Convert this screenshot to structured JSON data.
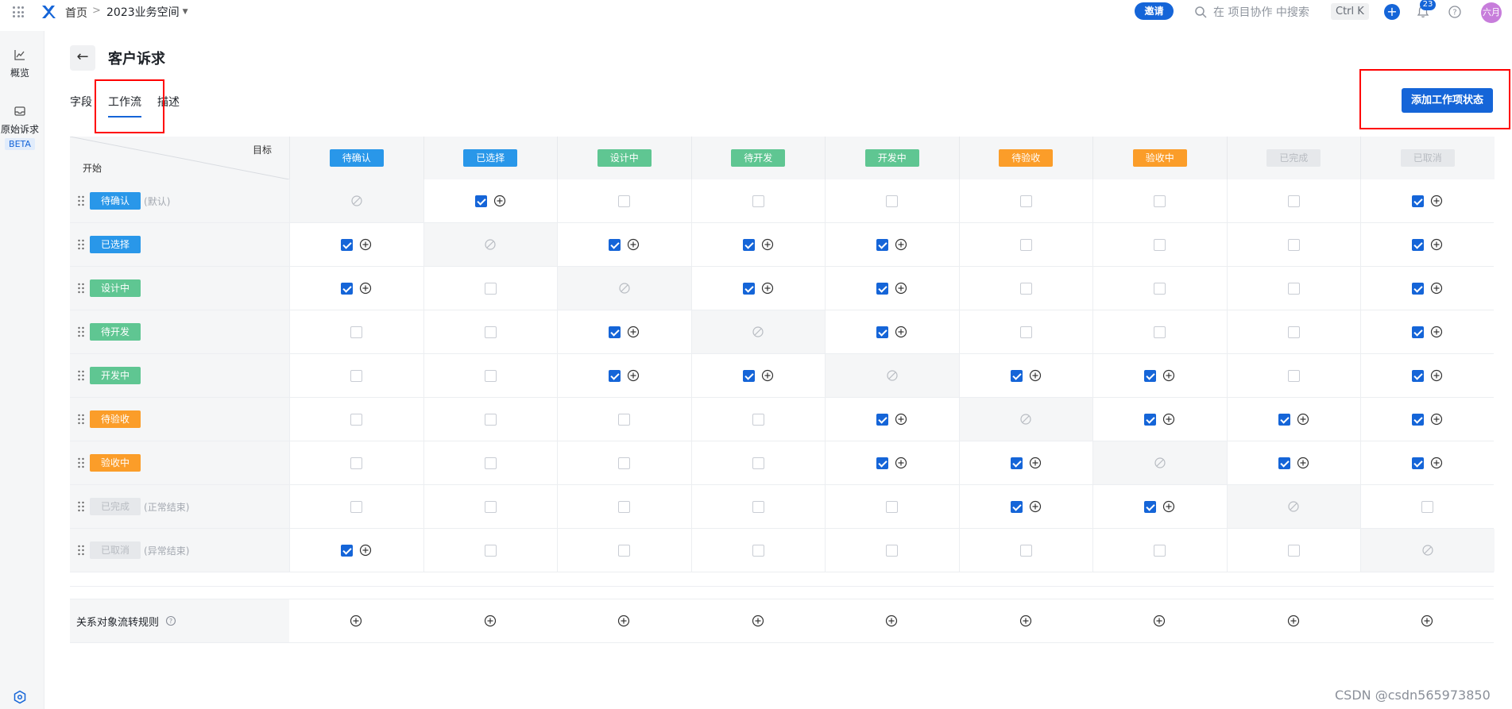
{
  "topbar": {
    "home": "首页",
    "separator": ">",
    "space": "2023业务空间",
    "invite": "邀请",
    "search_placeholder": "在 项目协作 中搜索",
    "shortcut": "Ctrl K",
    "plus": "+",
    "notification_count": "23",
    "avatar": "六月"
  },
  "rail": {
    "overview": "概览",
    "raw_requests": "原始诉求",
    "beta": "BETA"
  },
  "page": {
    "back": "←",
    "title": "客户诉求",
    "tabs": [
      "字段",
      "工作流",
      "描述"
    ],
    "active_tab": "工作流",
    "add_state_button": "添加工作项状态"
  },
  "matrix": {
    "target_label": "目标",
    "start_label": "开始",
    "states": [
      {
        "name": "待确认",
        "color": "blue",
        "note": "(默认)"
      },
      {
        "name": "已选择",
        "color": "blue",
        "note": ""
      },
      {
        "name": "设计中",
        "color": "green",
        "note": ""
      },
      {
        "name": "待开发",
        "color": "green",
        "note": ""
      },
      {
        "name": "开发中",
        "color": "green",
        "note": ""
      },
      {
        "name": "待验收",
        "color": "orange",
        "note": ""
      },
      {
        "name": "验收中",
        "color": "orange",
        "note": ""
      },
      {
        "name": "已完成",
        "color": "grey",
        "note": "(正常结束)"
      },
      {
        "name": "已取消",
        "color": "grey",
        "note": "(异常结束)"
      }
    ],
    "transitions": [
      [
        null,
        true,
        false,
        false,
        false,
        false,
        false,
        false,
        true
      ],
      [
        true,
        null,
        true,
        true,
        true,
        false,
        false,
        false,
        true
      ],
      [
        true,
        false,
        null,
        true,
        true,
        false,
        false,
        false,
        true
      ],
      [
        false,
        false,
        true,
        null,
        true,
        false,
        false,
        false,
        true
      ],
      [
        false,
        false,
        true,
        true,
        null,
        true,
        true,
        false,
        true
      ],
      [
        false,
        false,
        false,
        false,
        true,
        null,
        true,
        true,
        true
      ],
      [
        false,
        false,
        false,
        false,
        true,
        true,
        null,
        true,
        true
      ],
      [
        false,
        false,
        false,
        false,
        false,
        true,
        true,
        null,
        false
      ],
      [
        true,
        false,
        false,
        false,
        false,
        false,
        false,
        false,
        null
      ]
    ],
    "rule_row_label": "关系对象流转规则"
  },
  "colors": {
    "accent": "#1565d8",
    "blue_tag": "#2997e9",
    "green_tag": "#5fc692",
    "orange_tag": "#fb9d29",
    "grey_tag": "#e6e8eb",
    "annotation": "#ff0000"
  },
  "watermark": "CSDN @csdn565973850"
}
